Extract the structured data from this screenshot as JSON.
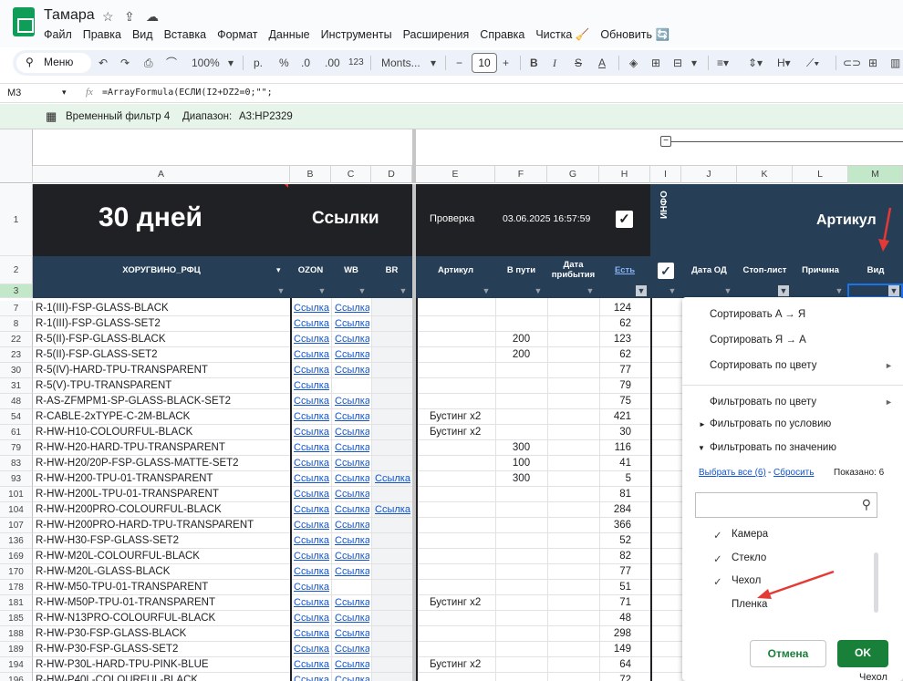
{
  "app": {
    "title": "Тамара"
  },
  "menu": [
    "Файл",
    "Правка",
    "Вид",
    "Вставка",
    "Формат",
    "Данные",
    "Инструменты",
    "Расширения",
    "Справка",
    "Чистка 🧹",
    "Обновить 🔄"
  ],
  "toolbar": {
    "search": "Меню",
    "zoom": "100%",
    "currency": "р.",
    "percent": "%",
    "dec_minus": ".0",
    "dec_plus": ".00",
    "numfmt": "123",
    "font": "Monts...",
    "font_size": "10",
    "bold": "B"
  },
  "formula_bar": {
    "cell": "M3",
    "fx": "fx",
    "formula": "=ArrayFormula(ЕСЛИ(I2+DZ2=0;\"\";"
  },
  "filter_bar": {
    "name": "Временный фильтр 4",
    "range_label": "Диапазон:",
    "range": "A3:HP2329"
  },
  "columns": [
    "A",
    "B",
    "C",
    "D",
    "E",
    "F",
    "G",
    "H",
    "I",
    "J",
    "K",
    "L",
    "M"
  ],
  "header_row1": {
    "days": "30 дней",
    "links": "Ссылки",
    "check_label": "Проверка",
    "check_date": "03.06.2025 16:57:59",
    "info": "ИНФО",
    "article": "Артикул"
  },
  "header_row2": {
    "a": "ХОРУГВИНО_РФЦ",
    "b": "OZON",
    "c": "WB",
    "d": "BR",
    "e": "Артикул",
    "f": "В пути",
    "g": "Дата прибытия",
    "h": "Есть",
    "j": "Дата ОД",
    "k": "Стоп-лист",
    "l": "Причина",
    "m": "Вид"
  },
  "rows": [
    {
      "n": "7",
      "a": "R-1(III)-FSP-GLASS-BLACK",
      "b": "Ссылка",
      "c": "Ссылка",
      "d": "",
      "e": "",
      "f": "",
      "h": "124"
    },
    {
      "n": "8",
      "a": "R-1(III)-FSP-GLASS-SET2",
      "b": "Ссылка",
      "c": "Ссылка",
      "d": "",
      "e": "",
      "f": "",
      "h": "62"
    },
    {
      "n": "22",
      "a": "R-5(II)-FSP-GLASS-BLACK",
      "b": "Ссылка",
      "c": "Ссылка",
      "d": "",
      "e": "",
      "f": "200",
      "h": "123"
    },
    {
      "n": "23",
      "a": "R-5(II)-FSP-GLASS-SET2",
      "b": "Ссылка",
      "c": "Ссылка",
      "d": "",
      "e": "",
      "f": "200",
      "h": "62"
    },
    {
      "n": "30",
      "a": "R-5(IV)-HARD-TPU-TRANSPARENT",
      "b": "Ссылка",
      "c": "Ссылка",
      "d": "",
      "e": "",
      "f": "",
      "h": "77"
    },
    {
      "n": "31",
      "a": "R-5(V)-TPU-TRANSPARENT",
      "b": "Ссылка",
      "c": "",
      "d": "",
      "e": "",
      "f": "",
      "h": "79"
    },
    {
      "n": "48",
      "a": "R-AS-ZFMPM1-SP-GLASS-BLACK-SET2",
      "b": "Ссылка",
      "c": "Ссылка",
      "d": "",
      "e": "",
      "f": "",
      "h": "75"
    },
    {
      "n": "54",
      "a": "R-CABLE-2xTYPE-C-2M-BLACK",
      "b": "Ссылка",
      "c": "Ссылка",
      "d": "",
      "e": "Бустинг x2",
      "f": "",
      "h": "421"
    },
    {
      "n": "61",
      "a": "R-HW-H10-COLOURFUL-BLACK",
      "b": "Ссылка",
      "c": "Ссылка",
      "d": "",
      "e": "Бустинг x2",
      "f": "",
      "h": "30"
    },
    {
      "n": "79",
      "a": "R-HW-H20-HARD-TPU-TRANSPARENT",
      "b": "Ссылка",
      "c": "Ссылка",
      "d": "",
      "e": "",
      "f": "300",
      "h": "116"
    },
    {
      "n": "83",
      "a": "R-HW-H20/20P-FSP-GLASS-MATTE-SET2",
      "b": "Ссылка",
      "c": "Ссылка",
      "d": "",
      "e": "",
      "f": "100",
      "h": "41"
    },
    {
      "n": "93",
      "a": "R-HW-H200-TPU-01-TRANSPARENT",
      "b": "Ссылка",
      "c": "Ссылка",
      "d": "Ссылка",
      "e": "",
      "f": "300",
      "h": "5"
    },
    {
      "n": "101",
      "a": "R-HW-H200L-TPU-01-TRANSPARENT",
      "b": "Ссылка",
      "c": "Ссылка",
      "d": "",
      "e": "",
      "f": "",
      "h": "81"
    },
    {
      "n": "104",
      "a": "R-HW-H200PRO-COLOURFUL-BLACK",
      "b": "Ссылка",
      "c": "Ссылка",
      "d": "Ссылка",
      "e": "",
      "f": "",
      "h": "284"
    },
    {
      "n": "107",
      "a": "R-HW-H200PRO-HARD-TPU-TRANSPARENT",
      "b": "Ссылка",
      "c": "Ссылка",
      "d": "",
      "e": "",
      "f": "",
      "h": "366"
    },
    {
      "n": "136",
      "a": "R-HW-H30-FSP-GLASS-SET2",
      "b": "Ссылка",
      "c": "Ссылка",
      "d": "",
      "e": "",
      "f": "",
      "h": "52"
    },
    {
      "n": "169",
      "a": "R-HW-M20L-COLOURFUL-BLACK",
      "b": "Ссылка",
      "c": "Ссылка",
      "d": "",
      "e": "",
      "f": "",
      "h": "82"
    },
    {
      "n": "170",
      "a": "R-HW-M20L-GLASS-BLACK",
      "b": "Ссылка",
      "c": "Ссылка",
      "d": "",
      "e": "",
      "f": "",
      "h": "77"
    },
    {
      "n": "178",
      "a": "R-HW-M50-TPU-01-TRANSPARENT",
      "b": "Ссылка",
      "c": "",
      "d": "",
      "e": "",
      "f": "",
      "h": "51"
    },
    {
      "n": "181",
      "a": "R-HW-M50P-TPU-01-TRANSPARENT",
      "b": "Ссылка",
      "c": "Ссылка",
      "d": "",
      "e": "Бустинг x2",
      "f": "",
      "h": "71"
    },
    {
      "n": "185",
      "a": "R-HW-N13PRO-COLOURFUL-BLACK",
      "b": "Ссылка",
      "c": "Ссылка",
      "d": "",
      "e": "",
      "f": "",
      "h": "48"
    },
    {
      "n": "188",
      "a": "R-HW-P30-FSP-GLASS-BLACK",
      "b": "Ссылка",
      "c": "Ссылка",
      "d": "",
      "e": "",
      "f": "",
      "h": "298"
    },
    {
      "n": "189",
      "a": "R-HW-P30-FSP-GLASS-SET2",
      "b": "Ссылка",
      "c": "Ссылка",
      "d": "",
      "e": "",
      "f": "",
      "h": "149"
    },
    {
      "n": "194",
      "a": "R-HW-P30L-HARD-TPU-PINK-BLUE",
      "b": "Ссылка",
      "c": "Ссылка",
      "d": "",
      "e": "Бустинг x2",
      "f": "",
      "h": "64"
    },
    {
      "n": "196",
      "a": "R-HW-P40L-COLOURFUL-BLACK",
      "b": "Ссылка",
      "c": "Ссылка",
      "d": "",
      "e": "",
      "f": "",
      "h": "72"
    }
  ],
  "filter_menu": {
    "sort_az": "Сортировать A → Я",
    "sort_za": "Сортировать Я → A",
    "sort_color": "Сортировать по цвету",
    "filter_color": "Фильтровать по цвету",
    "filter_condition": "Фильтровать по условию",
    "filter_value": "Фильтровать по значению",
    "select_all": "Выбрать все (6)",
    "dash": "-",
    "clear": "Сбросить",
    "shown": "Показано: 6",
    "values": [
      {
        "label": "Камера",
        "checked": true
      },
      {
        "label": "Стекло",
        "checked": true
      },
      {
        "label": "Чехол",
        "checked": true
      },
      {
        "label": "Пленка",
        "checked": false
      }
    ],
    "cancel": "Отмена",
    "ok": "OK"
  },
  "peek_cell": "Чехол",
  "colors": {
    "green": "#188038",
    "header_dark": "#202124",
    "header_blue": "#263f57",
    "link": "#1155cc",
    "arrow": "#e53935"
  }
}
